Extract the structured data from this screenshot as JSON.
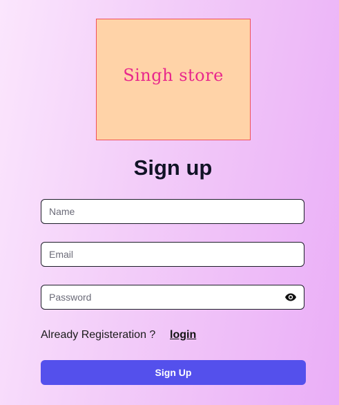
{
  "logo": {
    "text": "Singh store"
  },
  "form": {
    "title": "Sign up",
    "name_placeholder": "Name",
    "email_placeholder": "Email",
    "password_placeholder": "Password",
    "eye_icon": "eye-icon"
  },
  "footer": {
    "already_text": "Already Registeration ?",
    "login_label": "login"
  },
  "submit": {
    "label": "Sign Up"
  },
  "colors": {
    "accent": "#5450ec",
    "logo_bg": "#ffd3a8",
    "logo_text": "#e8288c",
    "logo_border": "#f0505a"
  }
}
